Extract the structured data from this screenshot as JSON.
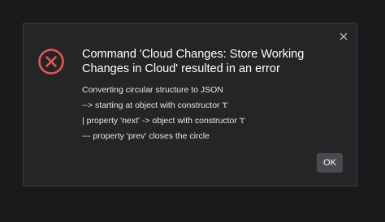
{
  "dialog": {
    "title": "Command 'Cloud Changes: Store Working Changes in Cloud' resulted in an error",
    "message_lines": [
      "Converting circular structure to JSON",
      "--> starting at object with constructor 't'",
      "| property 'next' -> object with constructor 't'",
      "--- property 'prev' closes the circle"
    ],
    "ok_label": "OK",
    "icon": "error-circle-x-icon",
    "close_icon": "close-icon"
  },
  "colors": {
    "backdrop": "#1a1a1c",
    "dialog_bg": "#252528",
    "dialog_border": "#3c3c44",
    "error_red": "#e05a4f",
    "button_bg": "#4a4a4e",
    "text": "#ffffff"
  }
}
